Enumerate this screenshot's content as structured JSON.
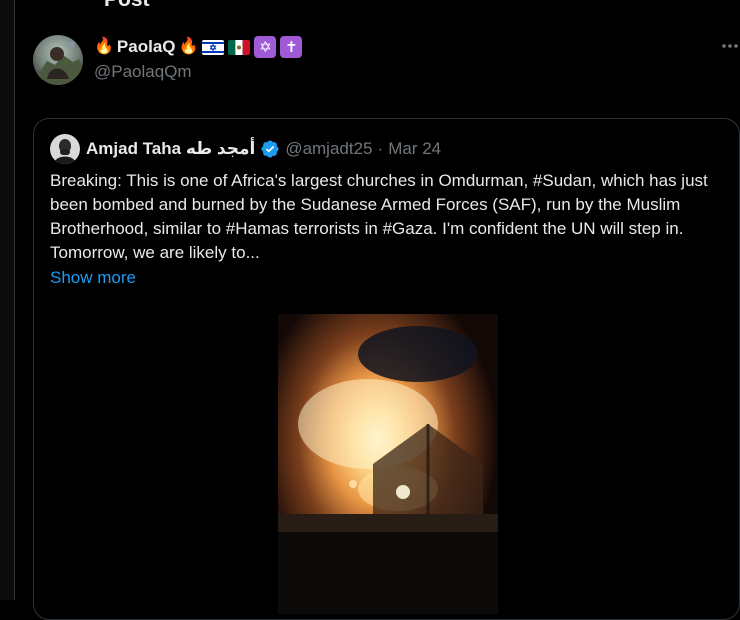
{
  "header": {
    "title": "Post",
    "back_icon": "arrow-left-icon"
  },
  "post": {
    "author": {
      "name": "PaolaQ",
      "handle": "@PaolaqQm",
      "name_emojis": [
        "fire-emoji",
        "fire-emoji",
        "israel-flag",
        "mexico-flag",
        "star-of-david-symbol",
        "latin-cross-symbol"
      ]
    },
    "more_icon": "ellipsis-icon",
    "quote": {
      "author_name": "Amjad Taha أمجد طه",
      "verified": true,
      "handle": "@amjadt25",
      "separator": "·",
      "date": "Mar 24",
      "text": "Breaking: This is one of Africa's largest churches in Omdurman, #Sudan, which has just been bombed and burned by the Sudanese Armed Forces (SAF), run by the Muslim Brotherhood, similar to #Hamas terrorists in #Gaza. I'm confident the UN will step in. Tomorrow, we are likely to...",
      "show_more": "Show more"
    }
  },
  "colors": {
    "background": "#000000",
    "text_primary": "#e7e9ea",
    "text_secondary": "#71767b",
    "link": "#1d9bf0",
    "border": "#2f3336",
    "verified": "#1d9bf0"
  }
}
